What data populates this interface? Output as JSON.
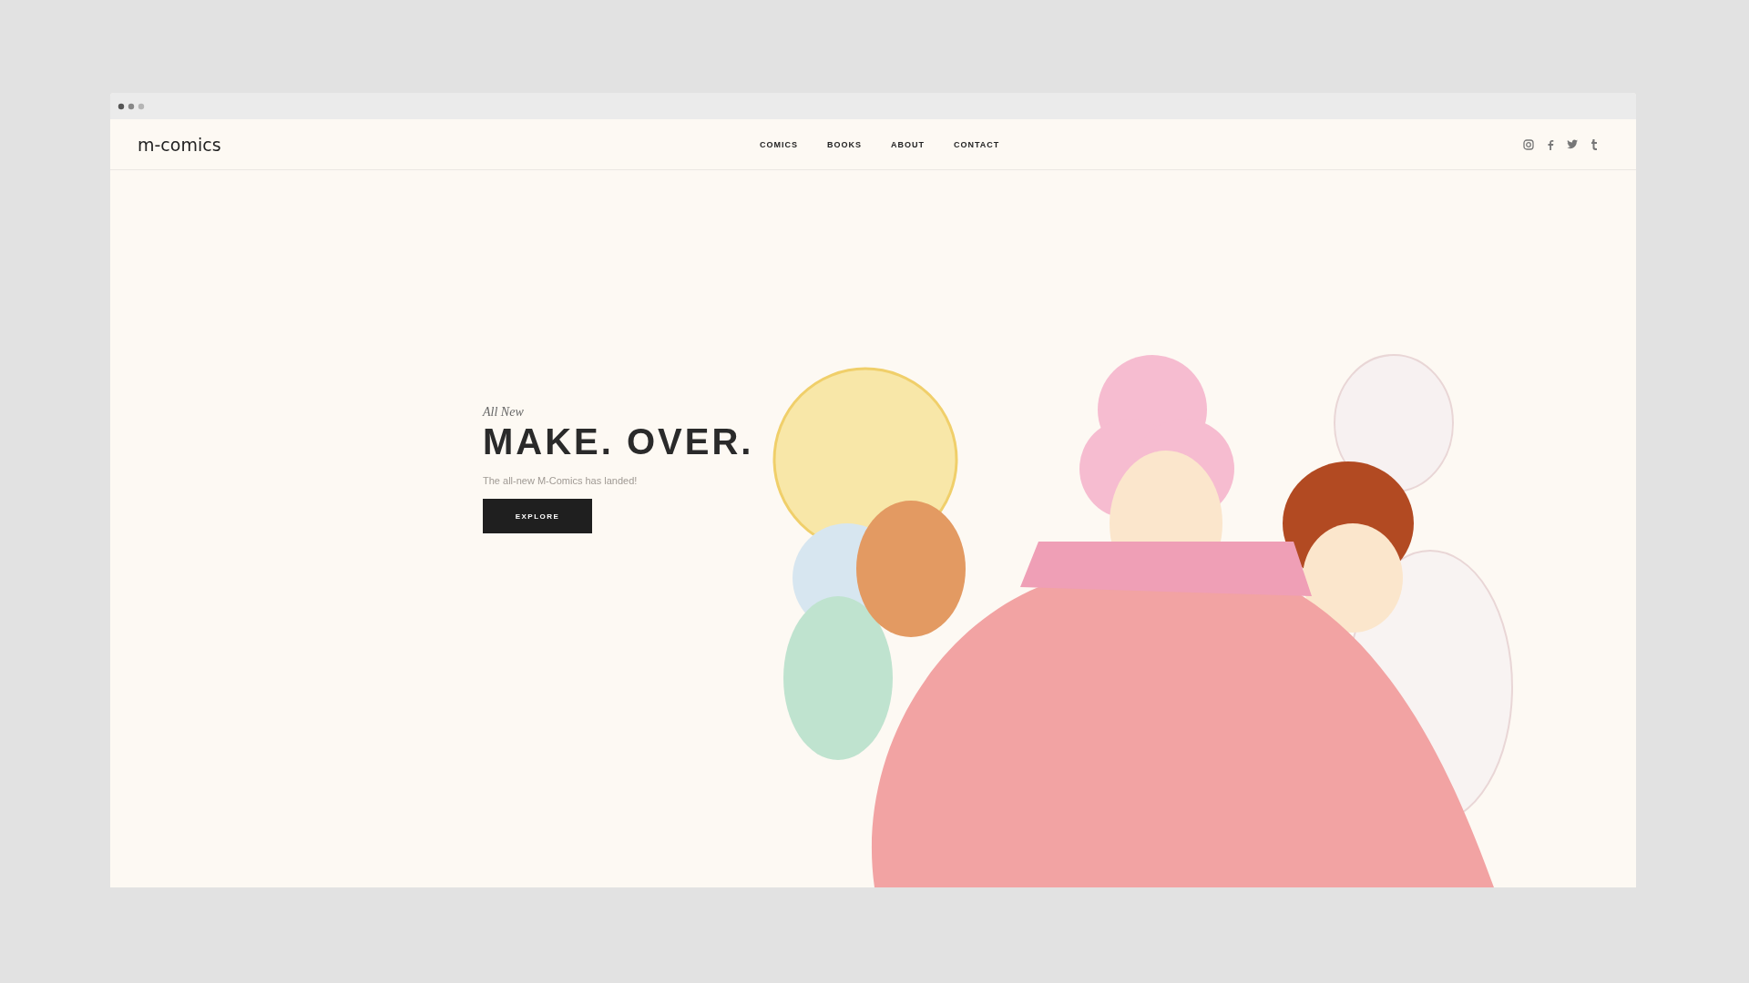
{
  "site": {
    "logo": "m-comics"
  },
  "nav": [
    {
      "label": "COMICS"
    },
    {
      "label": "BOOKS"
    },
    {
      "label": "ABOUT"
    },
    {
      "label": "CONTACT"
    }
  ],
  "hero": {
    "eyebrow": "All New",
    "title": "MAKE. OVER.",
    "subtitle": "The all-new M-Comics has landed!",
    "button": "EXPLORE"
  }
}
